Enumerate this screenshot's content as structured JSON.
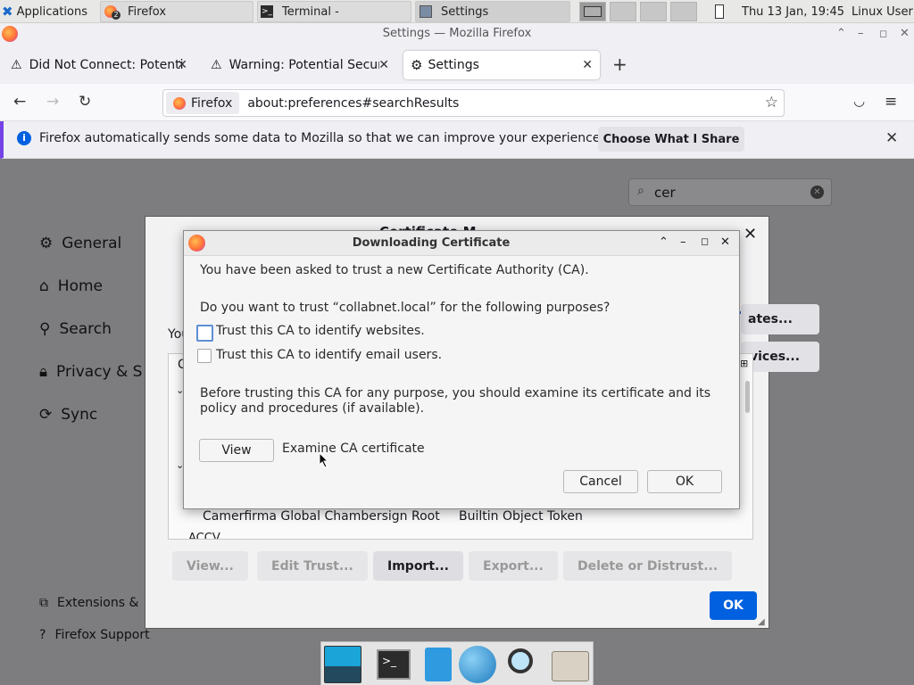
{
  "panel": {
    "applications_label": "Applications",
    "tasks": [
      {
        "label": "Firefox",
        "badge": "2"
      },
      {
        "label": "Terminal -"
      },
      {
        "label": "Settings"
      }
    ],
    "clock": "Thu 13 Jan, 19:45",
    "user": "Linux User"
  },
  "window": {
    "title": "Settings — Mozilla Firefox"
  },
  "tabs": [
    {
      "label": "Did Not Connect: Potenti",
      "icon": "warning-icon"
    },
    {
      "label": "Warning: Potential Securi",
      "icon": "warning-icon"
    },
    {
      "label": "Settings",
      "icon": "gear-icon"
    }
  ],
  "navbar": {
    "identity_label": "Firefox",
    "url": "about:preferences#searchResults"
  },
  "notification": {
    "message": "Firefox automatically sends some data to Mozilla so that we can improve your experience.",
    "button": "Choose What I Share"
  },
  "settings": {
    "search_value": "cer",
    "nav": [
      "General",
      "Home",
      "Search",
      "Privacy & S",
      "Sync"
    ],
    "footer": [
      "Extensions &",
      "Firefox Support"
    ]
  },
  "cert_manager": {
    "title_fragment": "Certificate M",
    "partial_label": "You",
    "column_partial": "C",
    "side_buttons": [
      "ates...",
      "vices..."
    ],
    "row": {
      "name": "Camerfirma Global Chambersign Root",
      "token": "Builtin Object Token"
    },
    "row_next": "ACCV",
    "buttons": [
      "View...",
      "Edit Trust...",
      "Import...",
      "Export...",
      "Delete or Distrust..."
    ],
    "ok": "OK"
  },
  "dialog": {
    "title": "Downloading Certificate",
    "intro": "You have been asked to trust a new Certificate Authority (CA).",
    "question": "Do you want to trust “collabnet.local” for the following purposes?",
    "options": [
      {
        "label": "Trust this CA to identify websites.",
        "checked": false
      },
      {
        "label": "Trust this CA to identify email users.",
        "checked": false
      }
    ],
    "note": "Before trusting this CA for any purpose, you should examine its certificate and its policy and procedures (if available).",
    "view_button": "View",
    "view_caption": "Examine CA certificate",
    "cancel": "Cancel",
    "ok": "OK"
  },
  "colors": {
    "accent": "#0060df",
    "notif_border": "#7542e5"
  }
}
